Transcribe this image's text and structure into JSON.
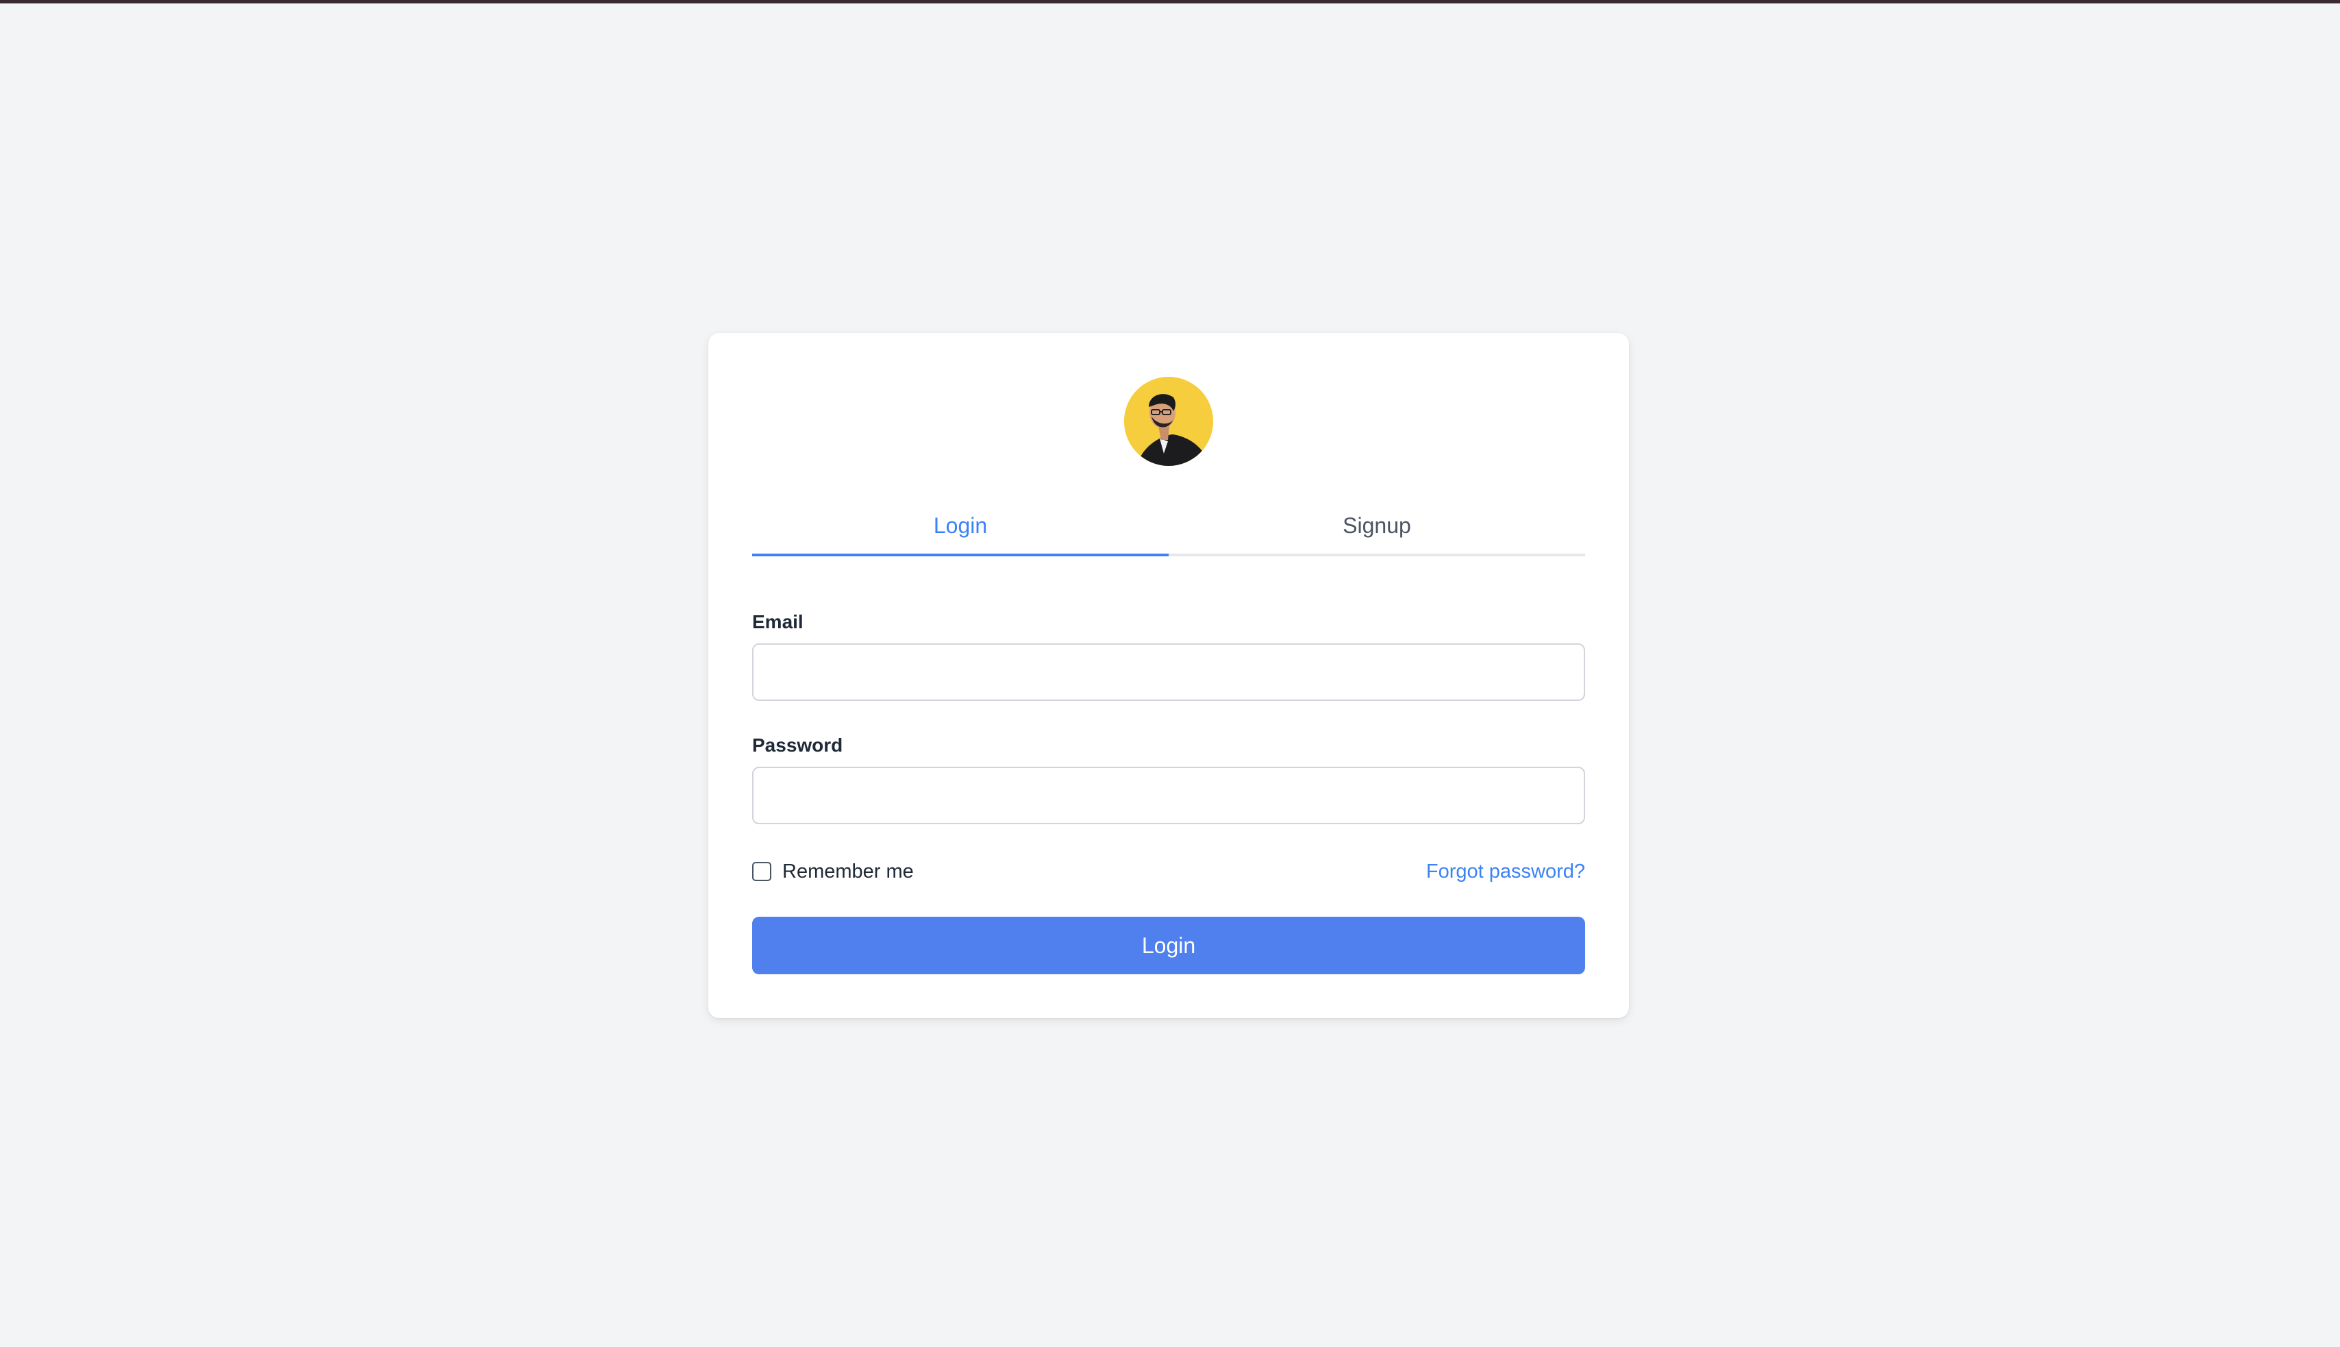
{
  "tabs": {
    "login_label": "Login",
    "signup_label": "Signup",
    "active": "login"
  },
  "form": {
    "email": {
      "label": "Email",
      "value": "",
      "placeholder": ""
    },
    "password": {
      "label": "Password",
      "value": "",
      "placeholder": ""
    },
    "remember_label": "Remember me",
    "remember_checked": false,
    "forgot_label": "Forgot password?",
    "submit_label": "Login"
  },
  "colors": {
    "accent": "#3b82f6",
    "button": "#4f80ee",
    "page_background": "#f3f4f6",
    "avatar_background": "#f6cd3c"
  },
  "icons": {
    "avatar": "user-avatar-photo"
  }
}
